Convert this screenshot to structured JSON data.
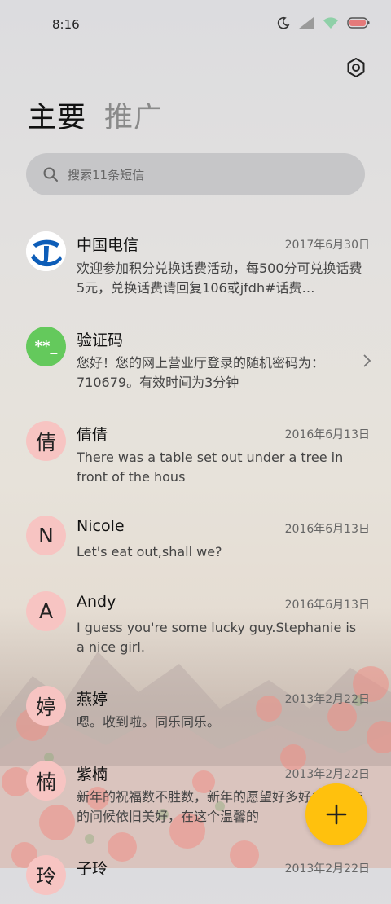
{
  "status_bar": {
    "time": "8:16"
  },
  "tabs": {
    "primary": "主要",
    "promotions": "推广"
  },
  "search": {
    "placeholder": "搜索11条短信"
  },
  "conversations": [
    {
      "avatar": "",
      "avatar_kind": "china-telecom-logo",
      "name": "中国电信",
      "date": "2017年6月30日",
      "message": "欢迎参加积分兑换话费活动，每500分可兑换话费5元，兑换话费请回复106或jfdh#话费…"
    },
    {
      "avatar": "**_",
      "avatar_kind": "verification-code",
      "name": "验证码",
      "date": "",
      "message": "您好！您的网上营业厅登录的随机密码为：710679。有效时间为3分钟"
    },
    {
      "avatar": "倩",
      "name": "倩倩",
      "date": "2016年6月13日",
      "message": "There was a table set out under a tree in front of the hous"
    },
    {
      "avatar": "N",
      "name": "Nicole",
      "date": "2016年6月13日",
      "message": "Let's eat out,shall we?"
    },
    {
      "avatar": "A",
      "name": "Andy",
      "date": "2016年6月13日",
      "message": "I guess you're some lucky guy.Stephanie is a nice girl."
    },
    {
      "avatar": "婷",
      "name": "燕婷",
      "date": "2013年2月22日",
      "message": "嗯。收到啦。同乐同乐。"
    },
    {
      "avatar": "楠",
      "name": "紫楠",
      "date": "2013年2月22日",
      "message": "新年的祝福数不胜数，新年的愿望好多好多，新年的问候依旧美好，在这个温馨的"
    },
    {
      "avatar": "玲",
      "name": "子玲",
      "date": "2013年2月22日",
      "message": ""
    }
  ],
  "colors": {
    "fab": "#ffc10d",
    "avatar_pink": "#f7c4c2",
    "avatar_green": "#64c95c",
    "telecom_blue": "#0d5db8"
  },
  "icons": {
    "settings": "settings-icon",
    "search": "search-icon",
    "compose": "plus-icon",
    "chevron": "chevron-right-icon"
  }
}
